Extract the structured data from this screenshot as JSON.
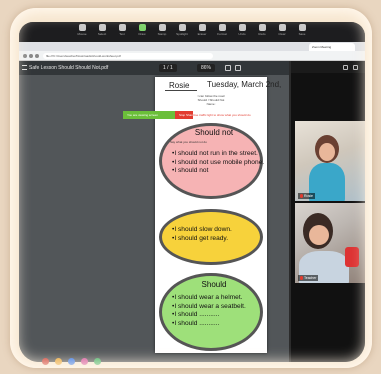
{
  "toolbar": {
    "buttons": [
      {
        "label": "Mouse",
        "icon": "pointer-icon"
      },
      {
        "label": "Select",
        "icon": "select-icon"
      },
      {
        "label": "Text",
        "icon": "text-icon"
      },
      {
        "label": "Draw",
        "icon": "pencil-icon"
      },
      {
        "label": "Stamp",
        "icon": "stamp-icon"
      },
      {
        "label": "Spotlight",
        "icon": "spotlight-icon"
      },
      {
        "label": "Eraser",
        "icon": "eraser-icon"
      },
      {
        "label": "Format",
        "icon": "palette-icon"
      },
      {
        "label": "Undo",
        "icon": "undo-icon"
      },
      {
        "label": "Redo",
        "icon": "redo-icon"
      },
      {
        "label": "Clear",
        "icon": "trash-icon"
      },
      {
        "label": "Save",
        "icon": "save-icon"
      }
    ],
    "active_index": 3
  },
  "browser": {
    "tab_title": "Zoom Meeting",
    "url": "file:///C:/Users/teacher/Downloads/should-worksheet.pdf"
  },
  "pdf": {
    "title": "Safe Lesson Should Should Not.pdf",
    "page_counter": "1 / 1",
    "zoom": "86%"
  },
  "worksheet": {
    "student_name": "Rosie",
    "date": "Tuesday, March 2nd,",
    "subtitle_lines": [
      "I can follow the road",
      "Should / Should Not",
      "Name:"
    ],
    "remote_control_label": "You are viewing screen",
    "stop_label": "Stop Share",
    "annotate_hint": "Use traffic light to show what you should do",
    "sections": [
      {
        "title": "Should not",
        "note": "Say what you should not do",
        "items": [
          "I should not run in the street.",
          "I should not use mobile phone.",
          "I should not"
        ]
      },
      {
        "title": "",
        "note": "",
        "items": [
          "I should slow down.",
          "I should get ready."
        ]
      },
      {
        "title": "Should",
        "note": "",
        "items": [
          "I should wear a helmet.",
          "I should wear a seatbelt.",
          "I should ...........",
          "I should ..........."
        ]
      }
    ]
  },
  "video": {
    "tiles": [
      {
        "label": "Rosie"
      },
      {
        "label": "Teacher"
      }
    ]
  },
  "colors": {
    "red_light": "#f6b3b4",
    "yellow_light": "#f7d23b",
    "green_light": "#9ee07a",
    "remote_green": "#6bbf3a",
    "stop_red": "#e23b2f"
  }
}
